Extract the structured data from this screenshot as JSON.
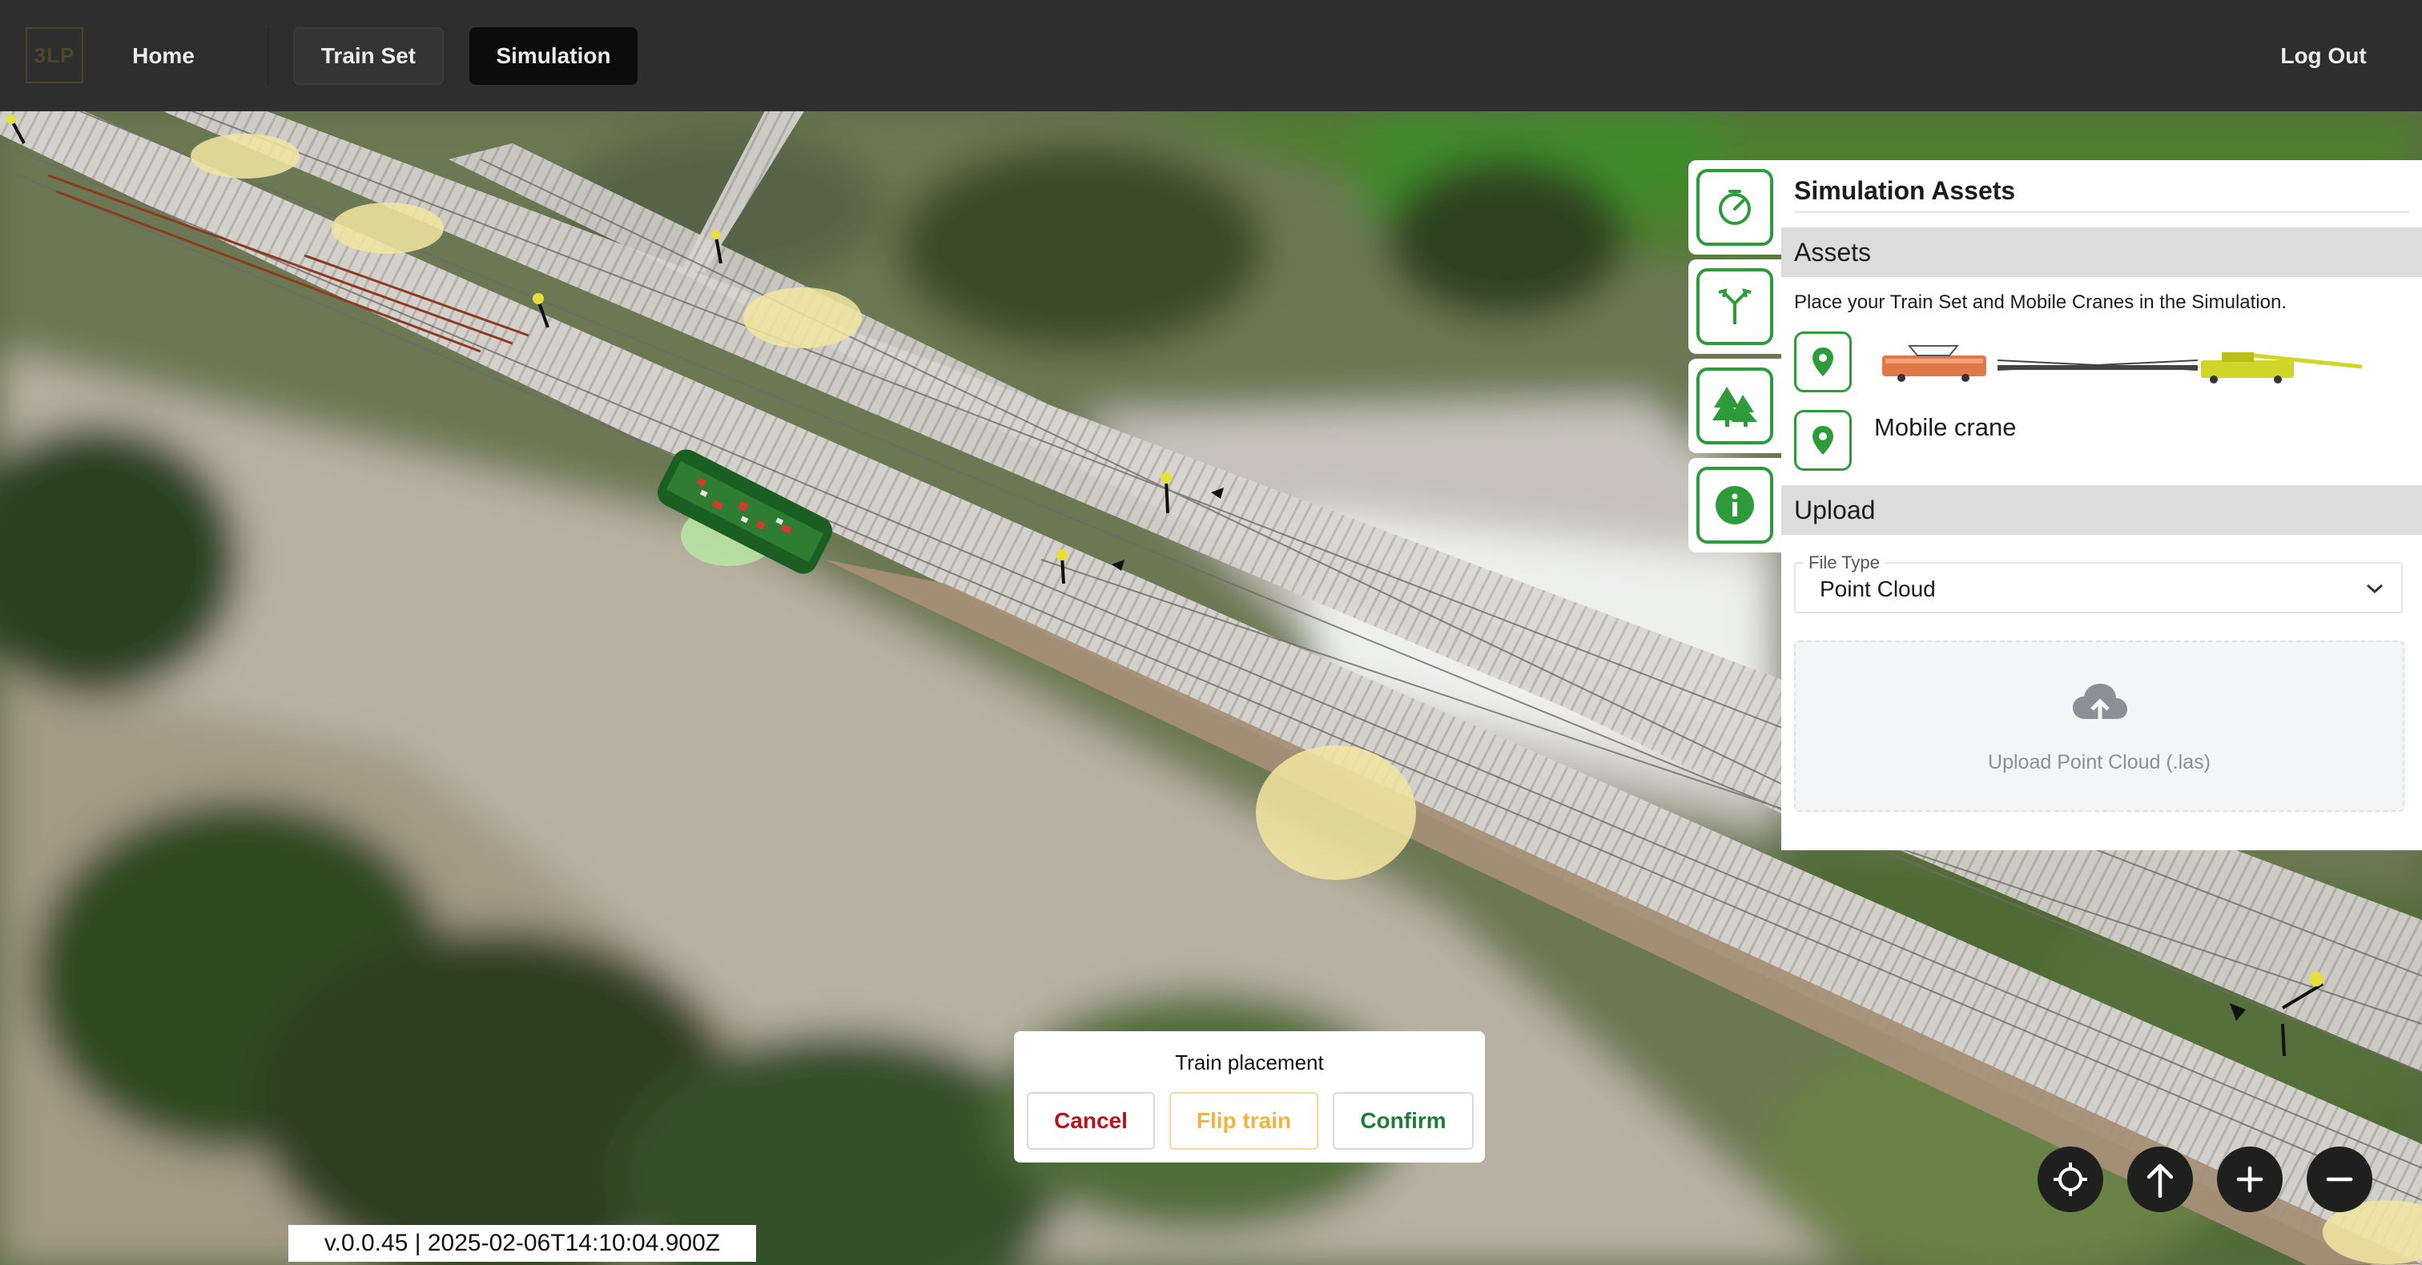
{
  "nav": {
    "logo": "3LP",
    "home": "Home",
    "train_set": "Train Set",
    "simulation": "Simulation",
    "logout": "Log Out"
  },
  "tools": [
    {
      "icon": "speed-timer-icon"
    },
    {
      "icon": "track-switch-icon"
    },
    {
      "icon": "trees-icon"
    },
    {
      "icon": "info-icon"
    }
  ],
  "panel": {
    "title": "Simulation Assets",
    "assets_heading": "Assets",
    "assets_description": "Place your Train Set and Mobile Cranes in the Simulation.",
    "crane_label": "Mobile crane",
    "upload_heading": "Upload",
    "file_type_label": "File Type",
    "file_type_value": "Point Cloud",
    "dropzone_text": "Upload Point Cloud (.las)"
  },
  "dialog": {
    "title": "Train placement",
    "cancel": "Cancel",
    "flip": "Flip train",
    "confirm": "Confirm"
  },
  "version": "v.0.0.45 | 2025-02-06T14:10:04.900Z",
  "colors": {
    "accent_green": "#2e9b3b",
    "cancel_red": "#b3161c",
    "flip_amber": "#f0b445",
    "confirm_green": "#1f7d36"
  }
}
